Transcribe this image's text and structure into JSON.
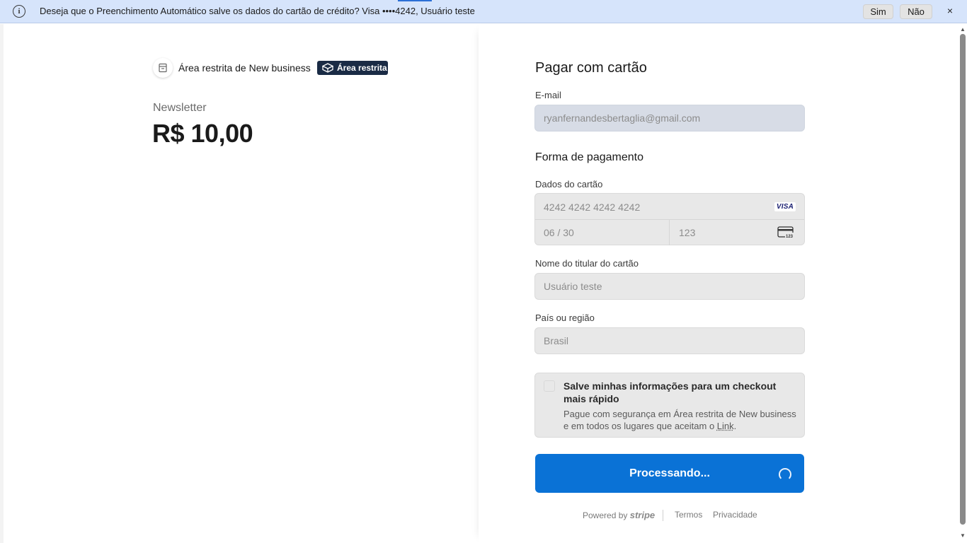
{
  "infobar": {
    "message": "Deseja que o Preenchimento Automático salve os dados do cartão de crédito? Visa  ••••4242, Usuário teste",
    "yes_label": "Sim",
    "no_label": "Não",
    "close_label": "×",
    "info_glyph": "i"
  },
  "summary": {
    "business_name": "Área restrita de New business",
    "badge_label": "Área restrita",
    "product_name": "Newsletter",
    "price": "R$ 10,00"
  },
  "form": {
    "title": "Pagar com cartão",
    "email_label": "E-mail",
    "email_value": "ryanfernandesbertaglia@gmail.com",
    "payment_section": "Forma de pagamento",
    "card_label": "Dados do cartão",
    "card_number": "4242 4242 4242 4242",
    "card_brand": "VISA",
    "card_expiry": "06 / 30",
    "card_cvc": "123",
    "cardholder_label": "Nome do titular do cartão",
    "cardholder_value": "Usuário teste",
    "country_label": "País ou região",
    "country_value": "Brasil",
    "save_title": "Salve minhas informações para um checkout mais rápido",
    "save_desc_prefix": "Pague com segurança em Área restrita de New business e em todos os lugares que aceitam o ",
    "save_desc_link": "Link",
    "save_desc_suffix": ".",
    "submit_label": "Processando..."
  },
  "footer": {
    "powered_by": "Powered by",
    "stripe": "stripe",
    "terms": "Termos",
    "privacy": "Privacidade"
  },
  "colors": {
    "infobar_bg": "#d6e4fb",
    "pay_button": "#0a72d6",
    "badge_bg": "#1a2b45"
  }
}
